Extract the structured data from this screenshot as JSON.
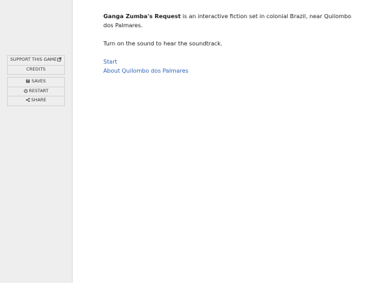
{
  "sidebar": {
    "top_menu": [
      {
        "label": "SUPPORT THIS GAME",
        "icon": "external-link-icon"
      },
      {
        "label": "CREDITS"
      }
    ],
    "bottom_menu": [
      {
        "label": "SAVES",
        "icon": "floppy-disk-icon"
      },
      {
        "label": "RESTART",
        "icon": "restart-icon"
      },
      {
        "label": "SHARE",
        "icon": "share-icon"
      }
    ]
  },
  "main": {
    "intro_title": "Ganga Zumba's Request",
    "intro_rest": " is an interactive fiction set in colonial Brazil, near Quilombo dos Palmares.",
    "sound_note": "Turn on the sound to hear the soundtrack.",
    "links": [
      {
        "label": "Start"
      },
      {
        "label": "About Quilombo dos Palmares"
      }
    ]
  },
  "colors": {
    "sidebar_bg": "#eeeeee",
    "link": "#2e63b7",
    "text": "#222222"
  }
}
